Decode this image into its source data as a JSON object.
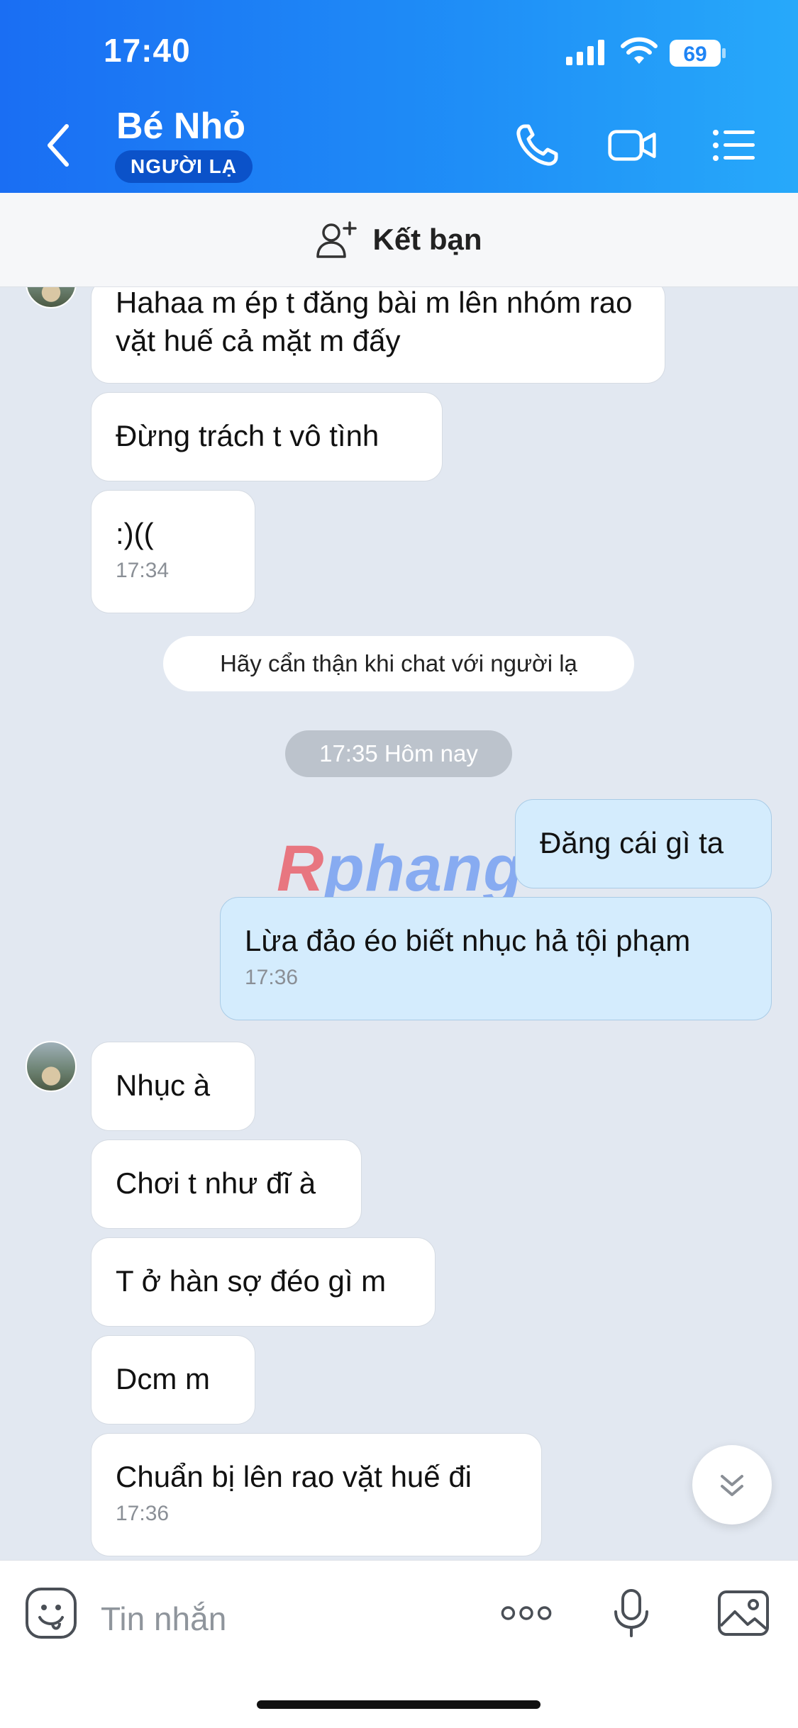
{
  "status_bar": {
    "time": "17:40",
    "battery": "69"
  },
  "header": {
    "contact_name": "Bé Nhỏ",
    "badge": "NGƯỜI LẠ"
  },
  "add_friend": {
    "label": "Kết bạn"
  },
  "messages": [
    {
      "side": "them",
      "text": "Hahaa m ép t đăng bài m lên nhóm rao vặt huế cả mặt m đấy"
    },
    {
      "side": "them",
      "text": "Đừng trách t vô tình"
    },
    {
      "side": "them",
      "text": ":)((",
      "time": "17:34"
    },
    {
      "side": "me",
      "text": "Đăng cái gì ta"
    },
    {
      "side": "me",
      "text": "Lừa đảo éo biết nhục hả tội phạm",
      "time": "17:36"
    },
    {
      "side": "them",
      "text": "Nhục à"
    },
    {
      "side": "them",
      "text": "Chơi t như đĩ à"
    },
    {
      "side": "them",
      "text": "T ở hàn sợ đéo gì m"
    },
    {
      "side": "them",
      "text": "Dcm m"
    },
    {
      "side": "them",
      "text": "Chuẩn bị lên rao vặt huế đi",
      "time": "17:36"
    }
  ],
  "system_notice": "Hãy cẩn thận khi chat với người lạ",
  "date_separator": "17:35 Hôm nay",
  "watermark": {
    "part1": "R",
    "part2": "phang"
  },
  "composer": {
    "placeholder": "Tin nhắn"
  },
  "colors": {
    "header": "#1a6ef3",
    "my_bubble": "#d4ecfd",
    "their_bubble": "#ffffff",
    "chat_bg": "#e2e8f1"
  },
  "icons": [
    "back-icon",
    "phone-icon",
    "video-icon",
    "menu-icon",
    "add-friend-icon",
    "sticker-icon",
    "more-icon",
    "mic-icon",
    "image-icon",
    "chevron-down-icon"
  ]
}
